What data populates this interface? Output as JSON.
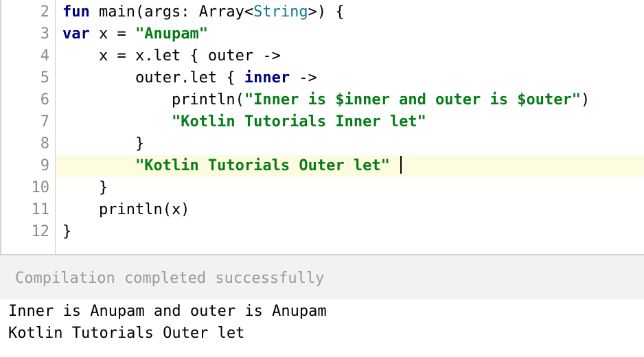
{
  "editor": {
    "lines": [
      {
        "number": "2",
        "tokens": [
          {
            "text": "fun",
            "style": "kw"
          },
          {
            "text": " main(args: Array<",
            "style": "plain"
          },
          {
            "text": "String",
            "style": "type-str"
          },
          {
            "text": ">) {",
            "style": "plain"
          }
        ]
      },
      {
        "number": "3",
        "tokens": [
          {
            "text": "var",
            "style": "kw"
          },
          {
            "text": " x = ",
            "style": "plain"
          },
          {
            "text": "\"Anupam\"",
            "style": "str"
          }
        ]
      },
      {
        "number": "4",
        "tokens": [
          {
            "text": "    x = x.let { outer ->",
            "style": "plain"
          }
        ]
      },
      {
        "number": "5",
        "tokens": [
          {
            "text": "        outer.let { ",
            "style": "plain"
          },
          {
            "text": "inner",
            "style": "kw"
          },
          {
            "text": " ->",
            "style": "plain"
          }
        ]
      },
      {
        "number": "6",
        "tokens": [
          {
            "text": "            println(",
            "style": "plain"
          },
          {
            "text": "\"Inner is $inner and outer is $outer\"",
            "style": "str"
          },
          {
            "text": ")",
            "style": "plain"
          }
        ]
      },
      {
        "number": "7",
        "tokens": [
          {
            "text": "            ",
            "style": "plain"
          },
          {
            "text": "\"Kotlin Tutorials Inner let\"",
            "style": "str"
          }
        ]
      },
      {
        "number": "8",
        "tokens": [
          {
            "text": "        }",
            "style": "plain"
          }
        ]
      },
      {
        "number": "9",
        "highlighted": true,
        "caret": true,
        "tokens": [
          {
            "text": "        ",
            "style": "plain"
          },
          {
            "text": "\"Kotlin Tutorials Outer let\"",
            "style": "str"
          },
          {
            "text": " ",
            "style": "plain"
          }
        ]
      },
      {
        "number": "10",
        "tokens": [
          {
            "text": "    }",
            "style": "plain"
          }
        ]
      },
      {
        "number": "11",
        "tokens": [
          {
            "text": "    println(x)",
            "style": "plain"
          }
        ]
      },
      {
        "number": "12",
        "tokens": [
          {
            "text": "}",
            "style": "plain"
          }
        ]
      }
    ]
  },
  "status": {
    "message": "Compilation completed successfully"
  },
  "output": {
    "lines": [
      "Inner is Anupam and outer is Anupam",
      "Kotlin Tutorials Outer let"
    ]
  },
  "colors": {
    "keyword": "#000080",
    "string": "#067d17",
    "type": "#0e7a8c",
    "line_number": "#8a8a8a",
    "current_line": "#fdfce0",
    "status_bg": "#f2f2f2",
    "status_text": "#9a9a9a"
  }
}
